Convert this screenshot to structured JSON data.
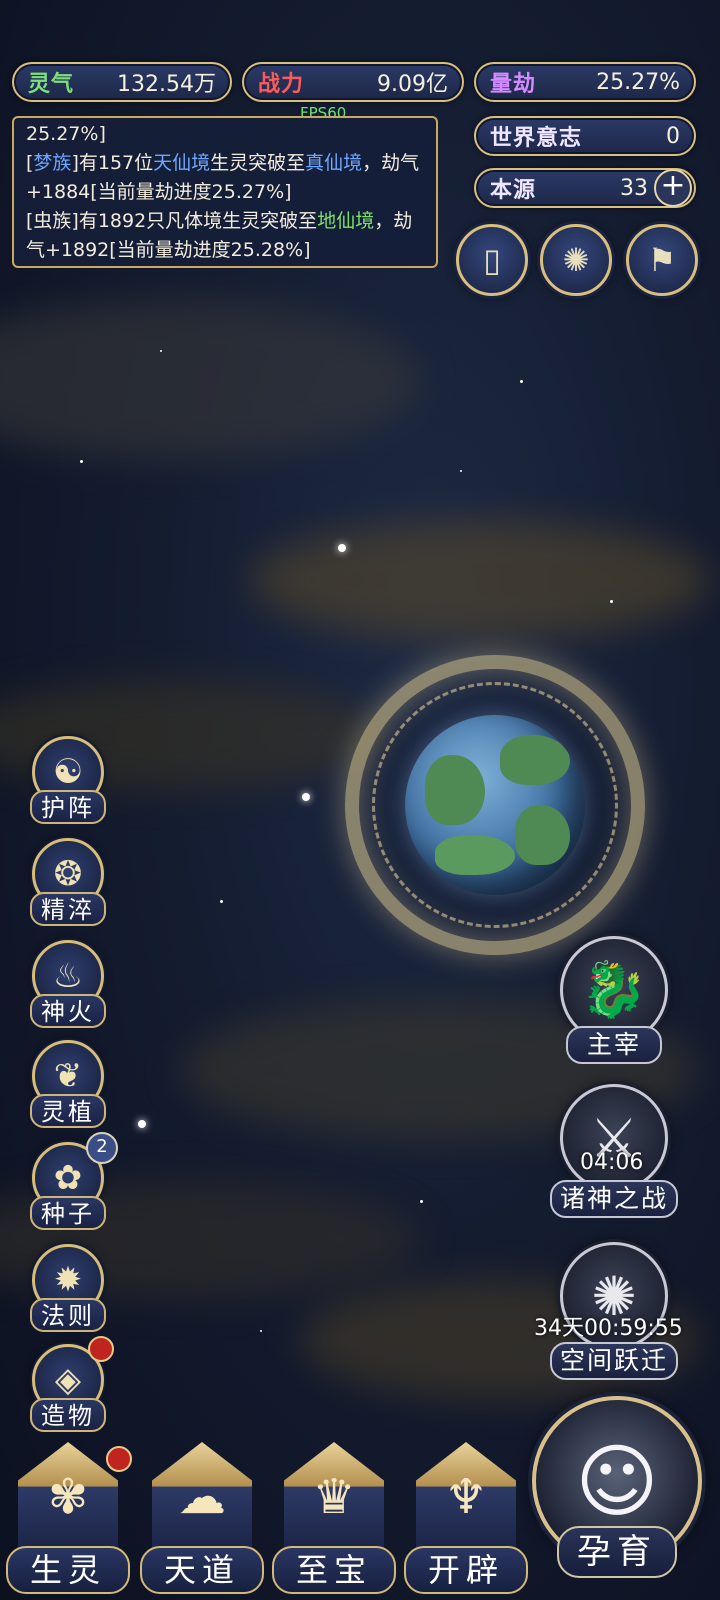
{
  "resources": {
    "lingqi": {
      "label": "灵气",
      "value": "132.54万",
      "label_color": "#7de07a"
    },
    "zhanli": {
      "label": "战力",
      "value": "9.09亿",
      "label_color": "#ff5a5a"
    },
    "liangjie": {
      "label": "量劫",
      "value": "25.27%",
      "label_color": "#d48bff"
    },
    "shijie": {
      "label": "世界意志",
      "value": "0"
    },
    "benyuan": {
      "label": "本源",
      "value": "33",
      "plus": "+"
    }
  },
  "fps": "FPS60",
  "log": {
    "line0": "25.27%]",
    "e1": {
      "p1": "[",
      "race": "梦族",
      "p2": "]有157位",
      "from": "天仙境",
      "p3": "生灵突破至",
      "to": "真仙境",
      "p4": "，劫气+1884[当前量劫进度25.27%]"
    },
    "e2": {
      "p1": "[虫族]有1892只凡体境生灵突破至",
      "to": "地仙境",
      "p4": "，劫气+1892[当前量劫进度25.28%]"
    }
  },
  "top_icons": {
    "card": "▯",
    "vortex": "✺",
    "flag": "⚑"
  },
  "side_menu": [
    {
      "label": "护阵",
      "icon": "☯"
    },
    {
      "label": "精淬",
      "icon": "❂"
    },
    {
      "label": "神火",
      "icon": "♨"
    },
    {
      "label": "灵植",
      "icon": "❦"
    },
    {
      "label": "种子",
      "icon": "✿",
      "badge": "2"
    },
    {
      "label": "法则",
      "icon": "✹"
    },
    {
      "label": "造物",
      "icon": "◈"
    }
  ],
  "features": {
    "zhuzai": {
      "label": "主宰",
      "icon": "🐉"
    },
    "zhushen": {
      "label": "诸神之战",
      "timer": "04:06",
      "icon": "⚔"
    },
    "kongjian": {
      "label": "空间跃迁",
      "timer": "34天00:59:55",
      "icon": "✺"
    }
  },
  "bottom_bar": [
    {
      "label": "生灵",
      "icon": "✾"
    },
    {
      "label": "天道",
      "icon": "☁"
    },
    {
      "label": "至宝",
      "icon": "♛"
    },
    {
      "label": "开辟",
      "icon": "♆"
    }
  ],
  "yunyu": {
    "label": "孕育",
    "icon": "☺"
  }
}
